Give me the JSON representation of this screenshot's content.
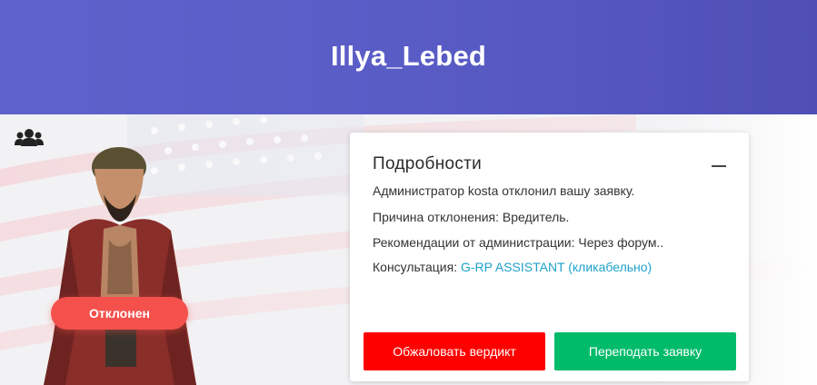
{
  "header": {
    "title": "Illya_Lebed"
  },
  "profile": {
    "group_icon": "group-icon",
    "status_label": "Отклонен",
    "status_color": "#f4514d"
  },
  "card": {
    "title": "Подробности",
    "collapse_icon": "minus-icon",
    "admin_line": "Администратор kosta отклонил вашу заявку.",
    "reason_line": "Причина отклонения: Вредитель.",
    "recommendation_line": "Рекомендации от администрации: Через форум..",
    "consultation_label": "Консультация:",
    "consultation_link": "G-RP ASSISTANT (кликабельно)",
    "appeal_button": "Обжаловать вердикт",
    "resubmit_button": "Переподать заявку"
  },
  "colors": {
    "header": "#5a5cc6",
    "link": "#1fa2c9",
    "appeal": "#fe0000",
    "resubmit": "#00bb6a"
  }
}
